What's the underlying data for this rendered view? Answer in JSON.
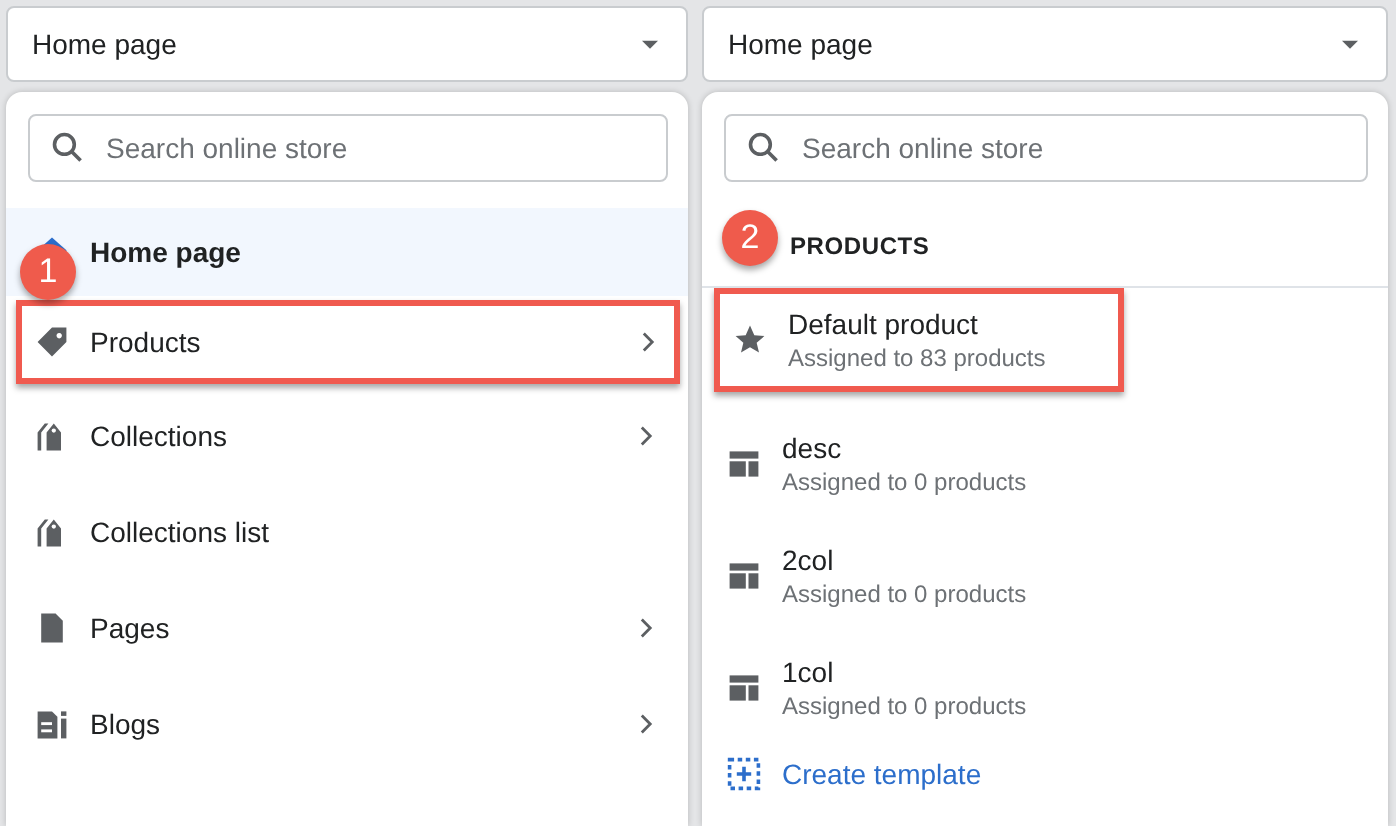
{
  "panels": [
    {
      "kind": "menu",
      "dropdown": {
        "value": "Home page"
      },
      "search": {
        "placeholder": "Search online store"
      },
      "items": [
        {
          "kind": "home",
          "label": "Home page",
          "selected": true,
          "highlighted": false,
          "has_children": false
        },
        {
          "kind": "tag",
          "label": "Products",
          "selected": false,
          "highlighted": true,
          "has_children": true,
          "callout": "1"
        },
        {
          "kind": "collection",
          "label": "Collections",
          "selected": false,
          "highlighted": false,
          "has_children": true
        },
        {
          "kind": "collection",
          "label": "Collections list",
          "selected": false,
          "highlighted": false,
          "has_children": false
        },
        {
          "kind": "page",
          "label": "Pages",
          "selected": false,
          "highlighted": false,
          "has_children": true
        },
        {
          "kind": "blog",
          "label": "Blogs",
          "selected": false,
          "highlighted": false,
          "has_children": true
        }
      ]
    },
    {
      "kind": "templates",
      "dropdown": {
        "value": "Home page"
      },
      "search": {
        "placeholder": "Search online store"
      },
      "section_title": "PRODUCTS",
      "callout": "2",
      "items": [
        {
          "kind": "star",
          "label": "Default product",
          "detail": "Assigned to 83 products",
          "highlighted": true
        },
        {
          "kind": "layout",
          "label": "desc",
          "detail": "Assigned to 0 products",
          "highlighted": false
        },
        {
          "kind": "layout",
          "label": "2col",
          "detail": "Assigned to 0 products",
          "highlighted": false
        },
        {
          "kind": "layout",
          "label": "1col",
          "detail": "Assigned to 0 products",
          "highlighted": false
        }
      ],
      "action": {
        "label": "Create template"
      }
    }
  ]
}
